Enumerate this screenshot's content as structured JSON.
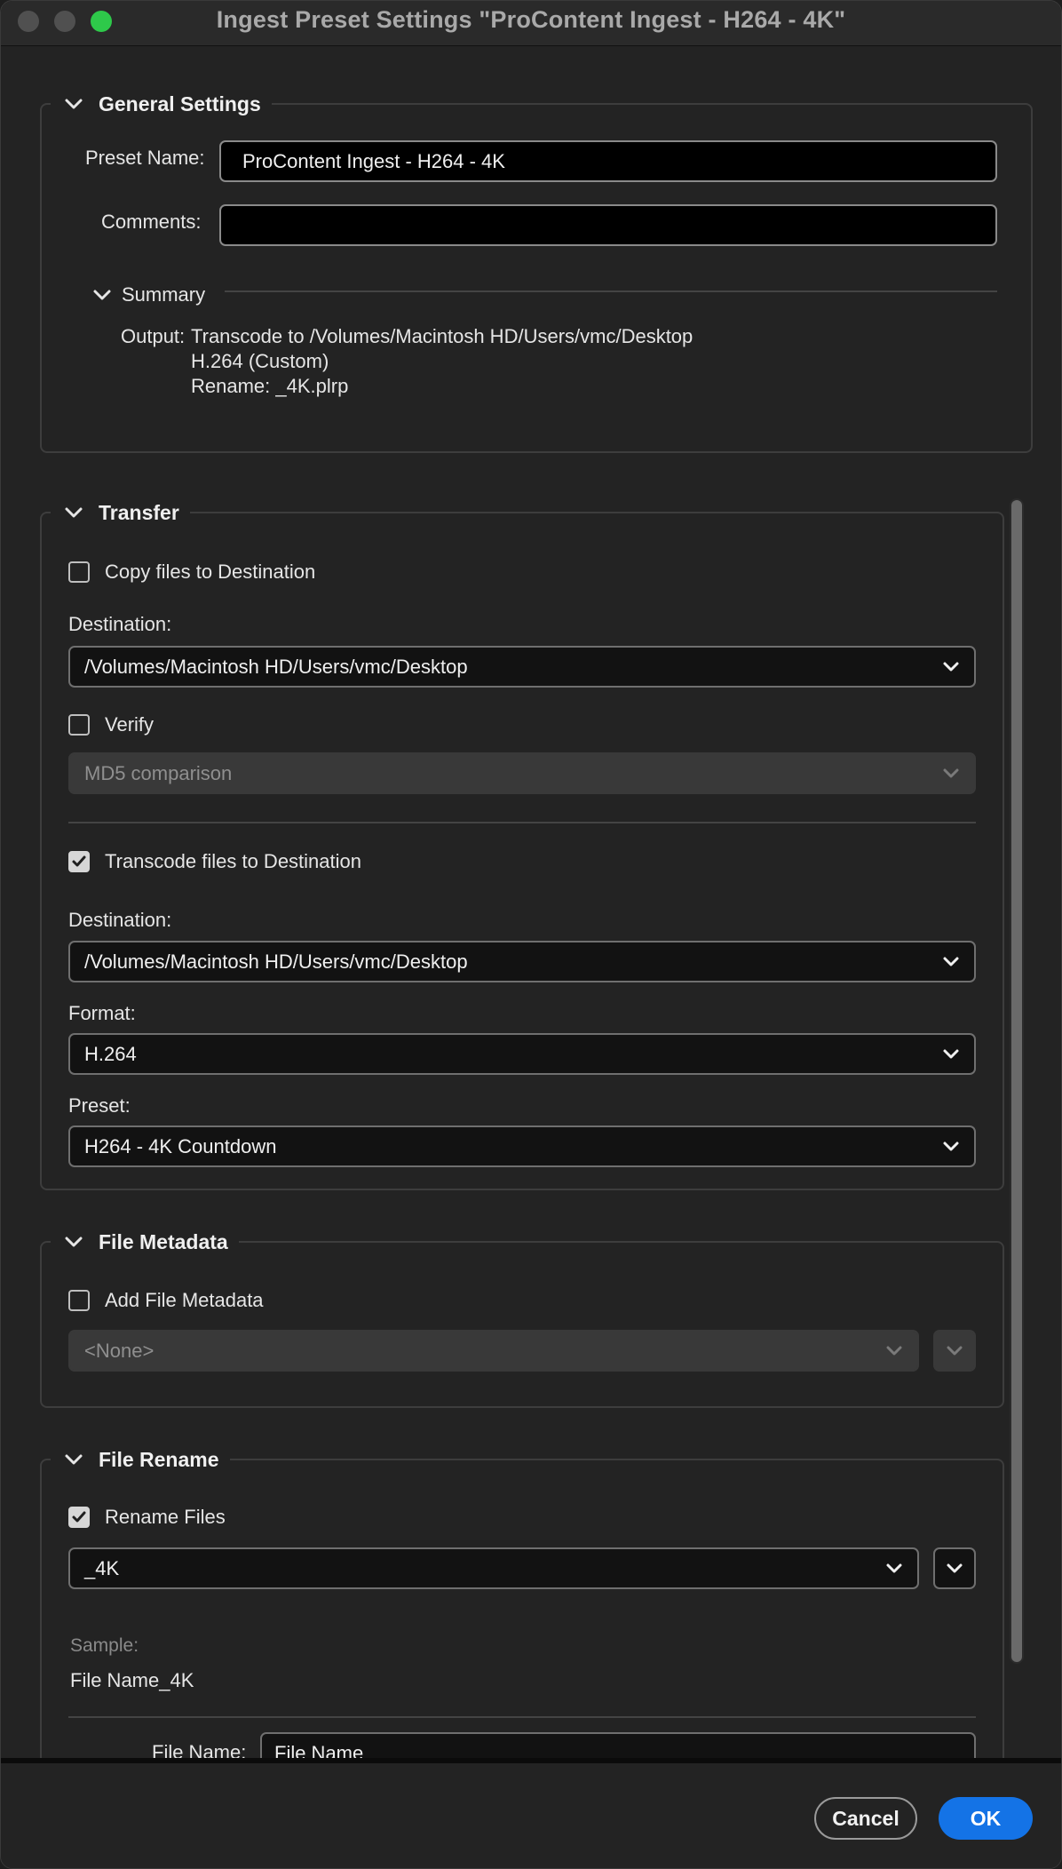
{
  "window": {
    "title": "Ingest Preset Settings \"ProContent Ingest - H264 - 4K\""
  },
  "general": {
    "title": "General Settings",
    "preset_name_label": "Preset Name:",
    "preset_name_value": "ProContent Ingest - H264 - 4K",
    "comments_label": "Comments:",
    "comments_value": "",
    "summary_title": "Summary",
    "output_label": "Output:",
    "output_lines": [
      "Transcode to /Volumes/Macintosh HD/Users/vmc/Desktop",
      "H.264 (Custom)",
      "Rename: _4K.plrp"
    ]
  },
  "transfer": {
    "title": "Transfer",
    "copy_label": "Copy files to Destination",
    "copy_checked": false,
    "copy_dest_label": "Destination:",
    "copy_dest_value": "/Volumes/Macintosh HD/Users/vmc/Desktop",
    "verify_label": "Verify",
    "verify_checked": false,
    "verify_method": "MD5 comparison",
    "transcode_label": "Transcode files to Destination",
    "transcode_checked": true,
    "transcode_dest_label": "Destination:",
    "transcode_dest_value": "/Volumes/Macintosh HD/Users/vmc/Desktop",
    "format_label": "Format:",
    "format_value": "H.264",
    "preset_label": "Preset:",
    "preset_value": "H264 - 4K Countdown"
  },
  "metadata": {
    "title": "File Metadata",
    "add_label": "Add File Metadata",
    "add_checked": false,
    "template_value": "<None>"
  },
  "rename": {
    "title": "File Rename",
    "rename_label": "Rename Files",
    "rename_checked": true,
    "template_value": "_4K",
    "sample_label": "Sample:",
    "sample_value": "File Name_4K",
    "file_name_label": "File Name:",
    "file_name_value": "File Name"
  },
  "footer": {
    "cancel_label": "Cancel",
    "ok_label": "OK"
  },
  "colors": {
    "accent": "#1473e6",
    "maximize": "#2ec94a",
    "background": "#232323"
  },
  "icons": {
    "chevron": "chevron-down-icon",
    "check": "checkmark-icon"
  }
}
